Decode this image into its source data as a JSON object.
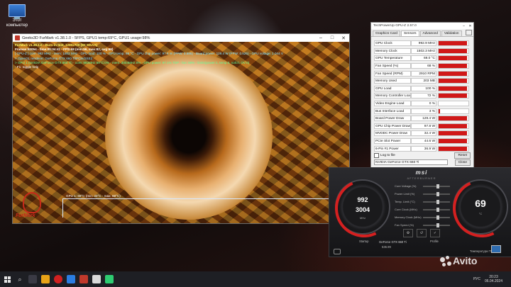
{
  "desktop": {
    "icon_label": "Этот компьютер"
  },
  "furmark": {
    "title": "Geeks3D FurMark v1.38.1.0 - 5FPS, GPU1 temp:69°C, GPU1 usage:98%",
    "hud": {
      "line1": "FurMark v1.38.1.0 - Burn-in test, 1280x720 (8X MSAA)",
      "line2": "Frames:52054 - time:00:04:41 - FPS:68 (min:56, max:82, avg:69)",
      "line3": "[ GPU-Z ] core: 992 MHz - mem: 1502 MHz - GPU load: 100 % - GPU temp: 69 °C - GPU chip power: 97.8 W (PPW: 0.695) - Board power: 129.4 W (PPW: 0.525) - GPU voltage: 1.044 V",
      "line4": "> OpenGL renderer: GeForce GTX 660 Ti/PCIe/SSE2",
      "line5": "> GPU 1 (NVIDIA GeForce GTX 660 Ti) - core: 992MHz:69°C:0% - mem: 3004MHz:0% - GPU power: 97.1% TDP - fan: 68% - limits(power:1, temp:0, volt:0, OV:0)",
      "line6": "- F1: toggle help"
    },
    "graph_label": "GPU 1: 69°C (min: 33°C - max: 69°C)",
    "logo_text": "FurMark"
  },
  "gpuz": {
    "title": "TechPowerUp GPU-Z 2.57.0",
    "tabs": [
      "Graphics Card",
      "Sensors",
      "Advanced",
      "Validation"
    ],
    "sensors": [
      {
        "name": "GPU Clock",
        "value": "992.9 MHz",
        "level": 0.95
      },
      {
        "name": "Memory Clock",
        "value": "1502.3 MHz",
        "level": 0.95
      },
      {
        "name": "GPU Temperature",
        "value": "69.0 °C",
        "level": 0.95
      },
      {
        "name": "Fan Speed (%)",
        "value": "68 %",
        "level": 0.95
      },
      {
        "name": "Fan Speed (RPM)",
        "value": "2910 RPM",
        "level": 0.95
      },
      {
        "name": "Memory Used",
        "value": "203 MB",
        "level": 0.95
      },
      {
        "name": "GPU Load",
        "value": "100 %",
        "level": 0.95
      },
      {
        "name": "Memory Controller Load",
        "value": "72 %",
        "level": 0.95
      },
      {
        "name": "Video Engine Load",
        "value": "0 %",
        "level": 0.0
      },
      {
        "name": "Bus Interface Load",
        "value": "3 %",
        "level": 0.05
      },
      {
        "name": "Board Power Draw",
        "value": "129.4 W",
        "level": 0.95
      },
      {
        "name": "GPU Chip Power Draw",
        "value": "97.8 W",
        "level": 0.95
      },
      {
        "name": "MVDDC Power Draw",
        "value": "32.4 W",
        "level": 0.95
      },
      {
        "name": "PCIe Slot Power",
        "value": "44.6 W",
        "level": 0.95
      },
      {
        "name": "6-Pin #1 Power",
        "value": "36.9 W",
        "level": 0.95
      }
    ],
    "log_label": "Log to file",
    "reset_label": "Reset",
    "gpu_select": "NVIDIA GeForce GTX 660 Ti",
    "close_label": "Close"
  },
  "afterburner": {
    "brand": "msi",
    "subtitle": "AFTERBURNER",
    "left_gauge": {
      "value1": "992",
      "value2": "3004",
      "unit": "MHz"
    },
    "right_gauge": {
      "value": "69",
      "unit": "°C"
    },
    "sliders": [
      "Core Voltage (%)",
      "Power Limit (%)",
      "Temp. Limit (°C)",
      "Core Clock (MHz)",
      "Memory Clock (MHz)",
      "Fan Speed (%)"
    ],
    "gpu_label": "GeForce GTX 660 Ti",
    "driver_label": "536.99",
    "startup_label": "Startup",
    "profile_label": "Profile",
    "temp_label": "Температура ГП, °C"
  },
  "taskbar": {
    "language": "РУС",
    "time": "20:23",
    "date": "06.04.2024"
  },
  "watermark": {
    "text": "Avito"
  }
}
